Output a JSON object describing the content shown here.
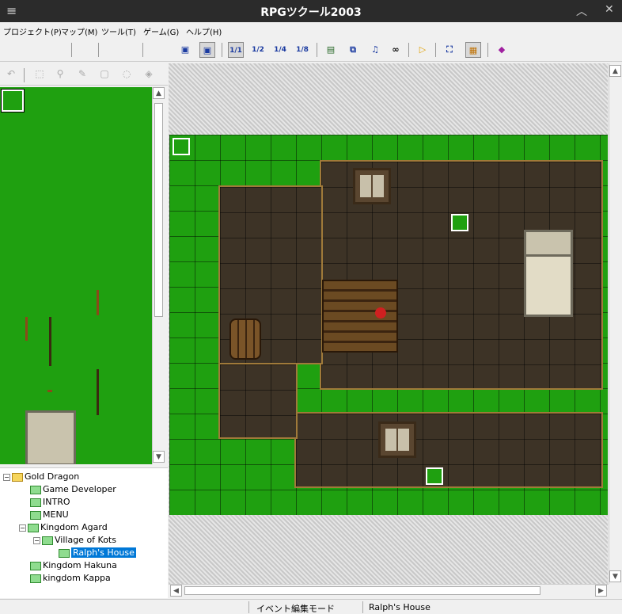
{
  "titlebar": {
    "title": "RPGツクール2003",
    "menu_icon": "hamburger-icon",
    "minimize_icon": "chevron-up-icon",
    "close_icon": "close-icon"
  },
  "menu": {
    "items": [
      "プロジェクト(P)",
      "マップ(M)",
      "ツール(T)",
      "ゲーム(G)",
      "ヘルプ(H)"
    ]
  },
  "toolbar": {
    "zoom_labels": [
      "1/1",
      "1/2",
      "1/4",
      "1/8"
    ],
    "icons": [
      "map-edit-icon",
      "event-edit-icon",
      "zoom-1-1-icon",
      "zoom-1-2-icon",
      "zoom-1-4-icon",
      "zoom-1-8-icon",
      "database-icon",
      "material-icon",
      "music-icon",
      "search-icon",
      "play-icon",
      "fullscreen-icon",
      "title-icon",
      "help-book-icon"
    ]
  },
  "left_tools": {
    "icons": [
      "undo-icon",
      "select-icon",
      "zoom-icon",
      "pencil-icon",
      "rectangle-icon",
      "circle-icon",
      "fill-icon"
    ]
  },
  "tree": {
    "items": [
      {
        "label": "Gold Dragon",
        "type": "folder",
        "depth": 0
      },
      {
        "label": "Game Developer",
        "type": "map",
        "depth": 1
      },
      {
        "label": "INTRO",
        "type": "map",
        "depth": 1
      },
      {
        "label": "MENU",
        "type": "map",
        "depth": 1
      },
      {
        "label": "Kingdom Agard",
        "type": "map",
        "depth": 1
      },
      {
        "label": "Village of Kots",
        "type": "map",
        "depth": 2
      },
      {
        "label": "Ralph's House",
        "type": "map",
        "depth": 3,
        "selected": true
      },
      {
        "label": "Kingdom Hakuna",
        "type": "map",
        "depth": 1
      },
      {
        "label": "kingdom Kappa",
        "type": "map",
        "depth": 1
      }
    ]
  },
  "status": {
    "mode": "イベント編集モード",
    "map_name": "Ralph's House"
  },
  "colors": {
    "grass": "#1fa010",
    "floor": "#3d3326",
    "selection": "#0078d7"
  }
}
